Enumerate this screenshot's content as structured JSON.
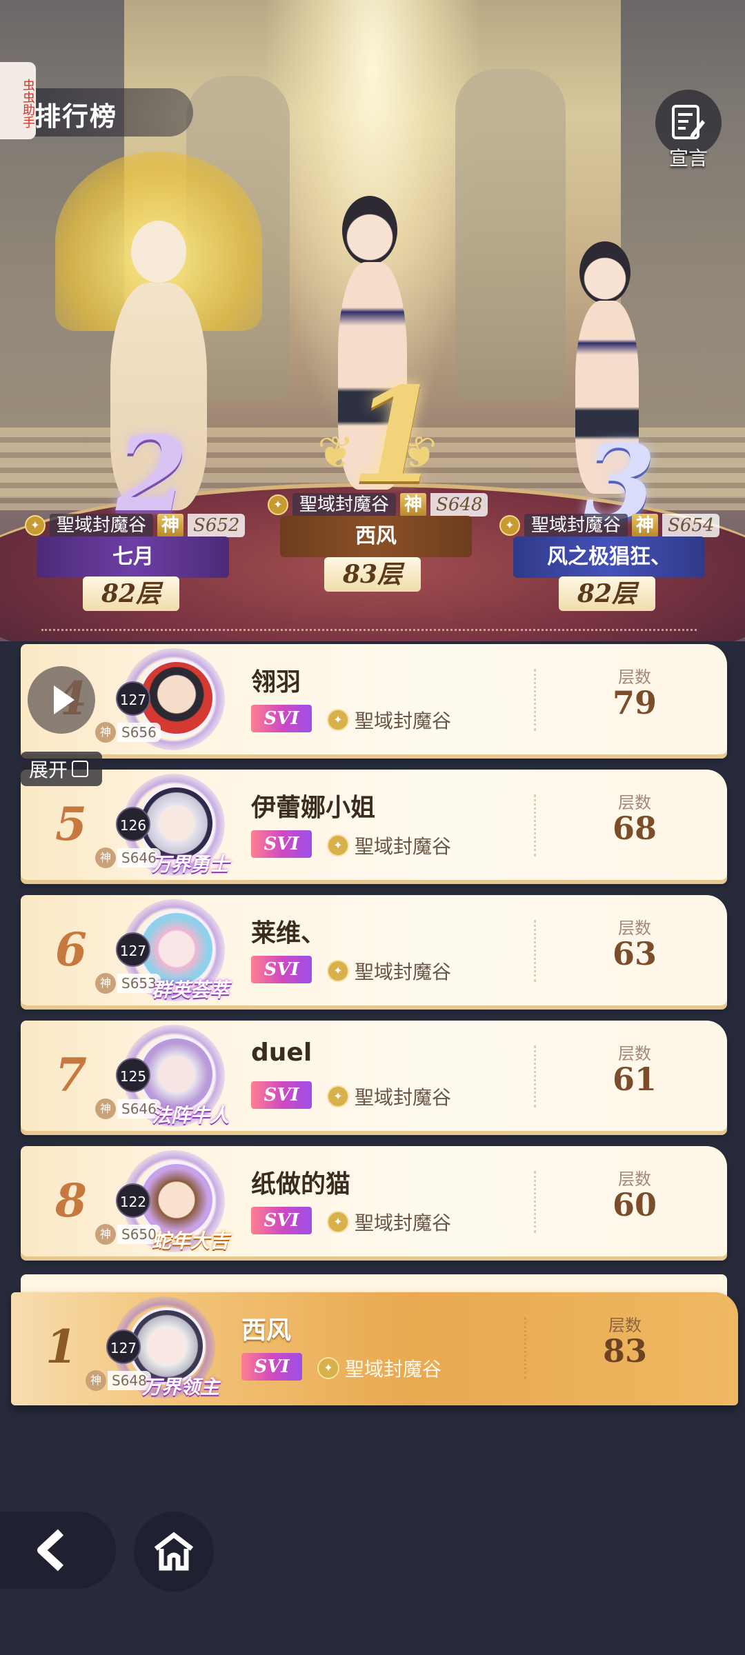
{
  "header": {
    "title": "排行榜",
    "helper_tag": "虫虫助手",
    "declare_label": "宣言"
  },
  "podium": {
    "first": {
      "rank": "1",
      "server_name": "聖域封魔谷",
      "god": "神",
      "zone": "S648",
      "name": "西风",
      "floors": "83层"
    },
    "second": {
      "rank": "2",
      "server_name": "聖域封魔谷",
      "god": "神",
      "zone": "S652",
      "name": "七月",
      "floors": "82层"
    },
    "third": {
      "rank": "3",
      "server_name": "聖域封魔谷",
      "god": "神",
      "zone": "S654",
      "name": "风之极猖狂、",
      "floors": "82层"
    }
  },
  "list_label_floors": "层数",
  "controls": {
    "expand_label": "展开"
  },
  "rows": [
    {
      "rank": "4",
      "level": "127",
      "god": "神",
      "zone": "S656",
      "name": "翎羽",
      "vip": "SVI",
      "server": "聖域封魔谷",
      "floors": "79",
      "title_badge": ""
    },
    {
      "rank": "5",
      "level": "126",
      "god": "神",
      "zone": "S646",
      "name": "伊蕾娜小姐",
      "vip": "SVI",
      "server": "聖域封魔谷",
      "floors": "68",
      "title_badge": "万界勇士"
    },
    {
      "rank": "6",
      "level": "127",
      "god": "神",
      "zone": "S653",
      "name": "莱维、",
      "vip": "SVI",
      "server": "聖域封魔谷",
      "floors": "63",
      "title_badge": "群英荟萃"
    },
    {
      "rank": "7",
      "level": "125",
      "god": "神",
      "zone": "S646",
      "name": "duel",
      "vip": "SVI",
      "server": "聖域封魔谷",
      "floors": "61",
      "title_badge": "法阵牛人"
    },
    {
      "rank": "8",
      "level": "122",
      "god": "神",
      "zone": "S650",
      "name": "纸做的猫",
      "vip": "SVI",
      "server": "聖域封魔谷",
      "floors": "60",
      "title_badge": "蛇年大吉"
    }
  ],
  "my_row": {
    "rank": "1",
    "level": "127",
    "god": "神",
    "zone": "S648",
    "name": "西风",
    "vip": "SVI",
    "server": "聖域封魔谷",
    "floors": "83",
    "title_badge": "万界领主"
  },
  "colors": {
    "gold": "#f3d37a",
    "purple": "#6d3fa5",
    "blue": "#4552b8",
    "row_bg": "#fff6e4",
    "accent_orange": "#e9a950"
  }
}
